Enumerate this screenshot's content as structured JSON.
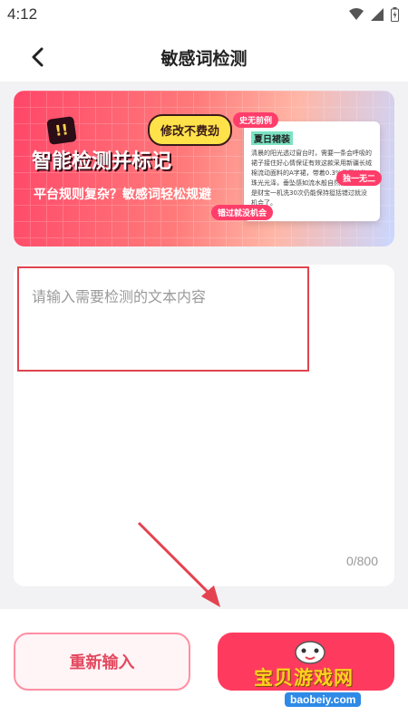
{
  "status_bar": {
    "time": "4:12"
  },
  "nav": {
    "title": "敏感词检测"
  },
  "banner": {
    "badge": "!!",
    "title": "智能检测并标记",
    "subtitle": "平台规则复杂？敏感词轻松规避",
    "bubble": "修改不费劲",
    "card_heading": "夏日裙装",
    "card_body": "清晨的阳光透过窗台时，需要一条会呼吸的裙子接住好心情保证有效这款采用新疆长绒棉流动面料的A字裙，带着0.3%桑蚕丝的珠光光泽，垂坠感如流水般自然，踩到真就是财宝一机洗30次仍能保持挺括错过就没机会了。",
    "tags": [
      "史无前例",
      "独一无二",
      "错过就没机会"
    ]
  },
  "input": {
    "placeholder": "请输入需要检测的文本内容",
    "value": "",
    "counter": "0/800"
  },
  "buttons": {
    "reset_label": "重新输入"
  },
  "watermark": {
    "text": "宝贝游戏网",
    "url": "baobeiy.com"
  }
}
